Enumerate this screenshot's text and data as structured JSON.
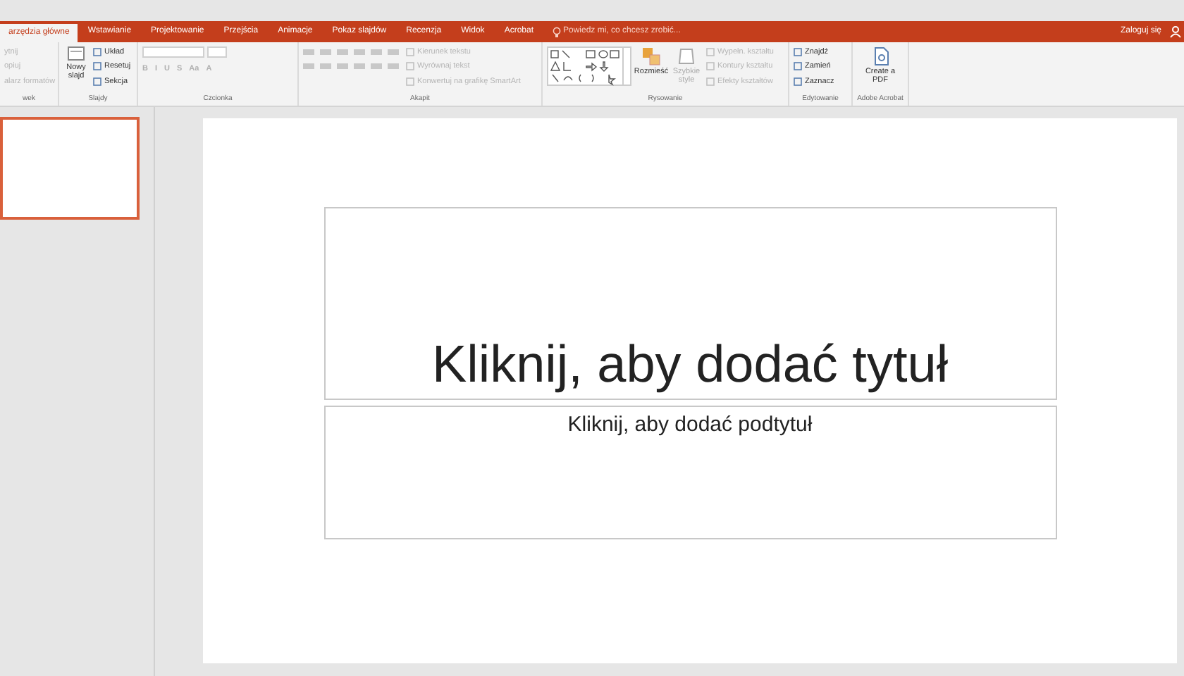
{
  "tabs": [
    {
      "label": "arzędzia główne",
      "selected": true
    },
    {
      "label": "Wstawianie",
      "selected": false
    },
    {
      "label": "Projektowanie",
      "selected": false
    },
    {
      "label": "Przejścia",
      "selected": false
    },
    {
      "label": "Animacje",
      "selected": false
    },
    {
      "label": "Pokaz slajdów",
      "selected": false
    },
    {
      "label": "Recenzja",
      "selected": false
    },
    {
      "label": "Widok",
      "selected": false
    },
    {
      "label": "Acrobat",
      "selected": false
    }
  ],
  "tell_me": "Powiedz mi, co chcesz zrobić...",
  "sign_in": "Zaloguj się",
  "clipboard": {
    "items": [
      {
        "label": "ytnij",
        "disabled": true
      },
      {
        "label": "opiuj",
        "disabled": true
      },
      {
        "label": "alarz formatów",
        "disabled": true
      }
    ],
    "group": "wek"
  },
  "slides_group": {
    "new_slide": "Nowy slajd",
    "items": [
      {
        "label": "Układ",
        "disabled": false
      },
      {
        "label": "Resetuj",
        "disabled": false
      },
      {
        "label": "Sekcja",
        "disabled": false
      }
    ],
    "group": "Slajdy"
  },
  "font_group": {
    "buttons": [
      "B",
      "I",
      "U",
      "S",
      "Aa",
      "A"
    ],
    "group": "Czcionka"
  },
  "paragraph_group": {
    "items": [
      {
        "label": "Kierunek tekstu",
        "disabled": true
      },
      {
        "label": "Wyrównaj tekst",
        "disabled": true
      },
      {
        "label": "Konwertuj na grafikę SmartArt",
        "disabled": true
      }
    ],
    "group": "Akapit"
  },
  "drawing_group": {
    "arrange": "Rozmieść",
    "quick_styles": "Szybkie style",
    "items": [
      {
        "label": "Wypełn. kształtu",
        "disabled": true
      },
      {
        "label": "Kontury kształtu",
        "disabled": true
      },
      {
        "label": "Efekty kształtów",
        "disabled": true
      }
    ],
    "group": "Rysowanie"
  },
  "editing_group": {
    "items": [
      {
        "label": "Znajdź",
        "disabled": false
      },
      {
        "label": "Zamień",
        "disabled": false
      },
      {
        "label": "Zaznacz",
        "disabled": false
      }
    ],
    "group": "Edytowanie"
  },
  "acrobat_group": {
    "button": "Create a PDF",
    "group": "Adobe Acrobat"
  },
  "thumbnails": [
    {
      "selected": true
    }
  ],
  "slide": {
    "title_placeholder": "Kliknij, aby dodać tytuł",
    "subtitle_placeholder": "Kliknij, aby dodać podtytuł"
  }
}
